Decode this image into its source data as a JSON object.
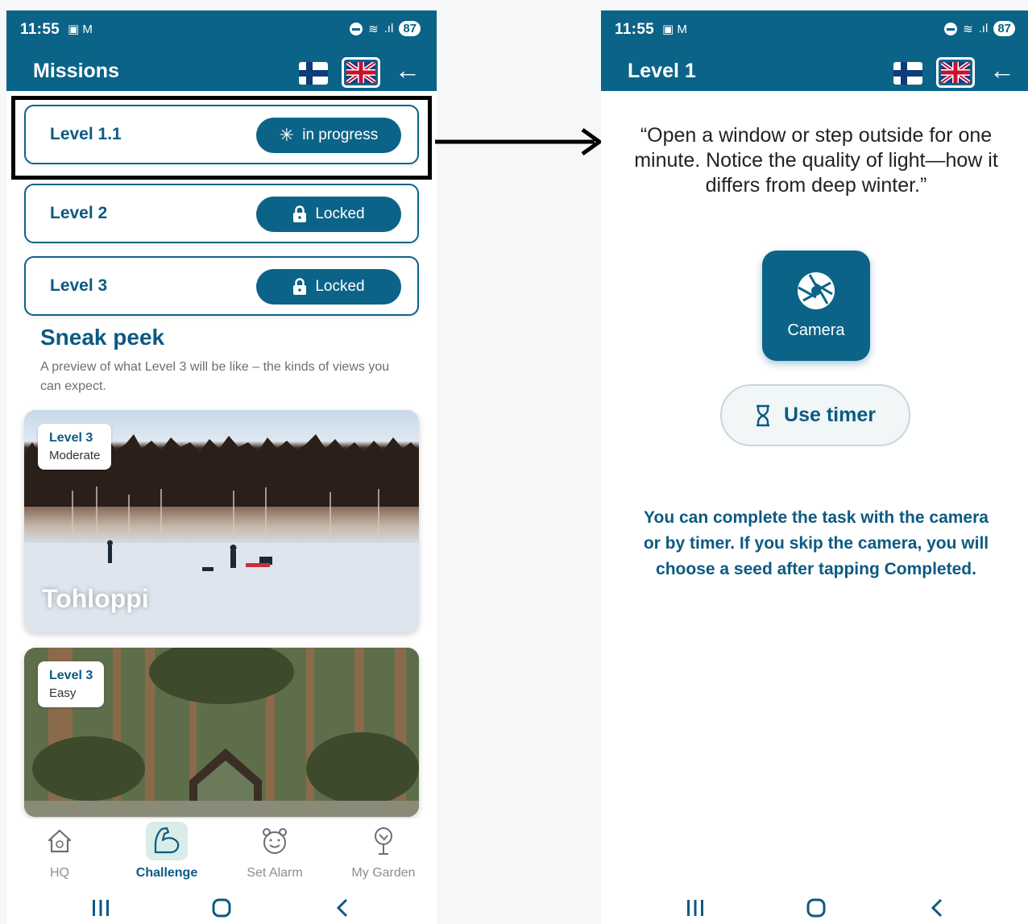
{
  "status_bar": {
    "time": "11:55",
    "battery": "87"
  },
  "left_screen": {
    "title": "Missions",
    "levels": [
      {
        "name": "Level 1.1",
        "status": "in progress"
      },
      {
        "name": "Level 2",
        "status": "Locked"
      },
      {
        "name": "Level 3",
        "status": "Locked"
      }
    ],
    "sneak_peek": {
      "title": "Sneak peek",
      "description": "A preview of what Level 3 will be like – the kinds of views you can expect."
    },
    "previews": [
      {
        "level": "Level 3",
        "difficulty": "Moderate",
        "label": "Tohloppi"
      },
      {
        "level": "Level 3",
        "difficulty": "Easy",
        "label": ""
      }
    ],
    "bottom_nav": [
      {
        "label": "HQ",
        "icon": "home-icon"
      },
      {
        "label": "Challenge",
        "icon": "flexed-arm-icon",
        "active": true
      },
      {
        "label": "Set Alarm",
        "icon": "alarm-clock-icon"
      },
      {
        "label": "My Garden",
        "icon": "tree-icon"
      }
    ]
  },
  "right_screen": {
    "title": "Level 1",
    "quote": "“Open a window or step outside for one minute. Notice the quality of light—how it differs from deep winter.”",
    "camera_label": "Camera",
    "timer_label": "Use timer",
    "info": "You can complete the task with the camera or by timer. If you skip the camera, you will choose a seed after tapping Completed."
  },
  "colors": {
    "primary": "#0c6388",
    "accent_text": "#0c5a82",
    "annotation": "#000000"
  }
}
